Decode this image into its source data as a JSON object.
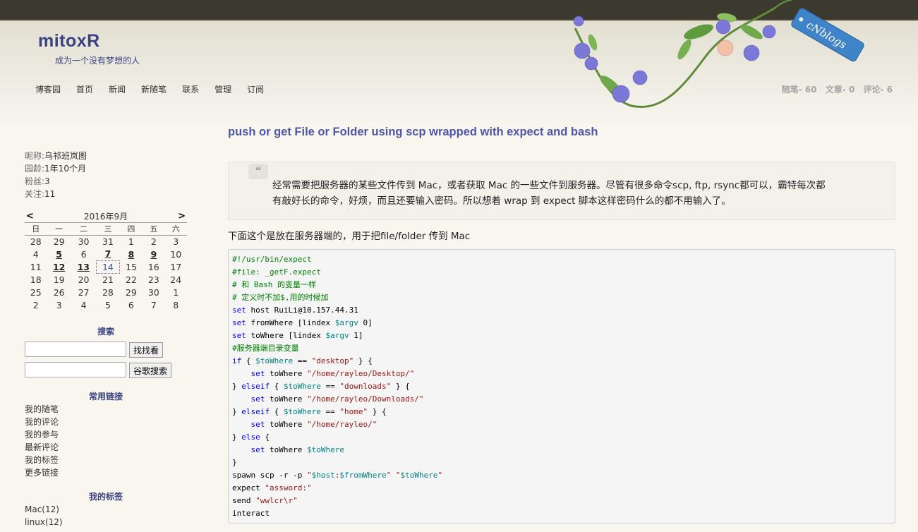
{
  "header": {
    "title": "mitoxR",
    "subtitle": "成为一个没有梦想的人",
    "nav": [
      "博客园",
      "首页",
      "新闻",
      "新随笔",
      "联系",
      "管理",
      "订阅"
    ],
    "stats": [
      "随笔- 60",
      "文章- 0",
      "评论- 6"
    ],
    "badge": "cNblogs"
  },
  "profile": {
    "nickname_label": "昵称:",
    "nickname": "乌祁班岚图",
    "age_label": "园龄:",
    "age": "1年10个月",
    "fans_label": "粉丝:",
    "fans": "3",
    "follow_label": "关注:",
    "follow": "11"
  },
  "calendar": {
    "prev": "<",
    "next": ">",
    "month": "2016年9月",
    "weekdays": [
      "日",
      "一",
      "二",
      "三",
      "四",
      "五",
      "六"
    ],
    "weeks": [
      [
        "28",
        "29",
        "30",
        "31",
        "1",
        "2",
        "3"
      ],
      [
        "4",
        "5",
        "6",
        "7",
        "8",
        "9",
        "10"
      ],
      [
        "11",
        "12",
        "13",
        "14",
        "15",
        "16",
        "17"
      ],
      [
        "18",
        "19",
        "20",
        "21",
        "22",
        "23",
        "24"
      ],
      [
        "25",
        "26",
        "27",
        "28",
        "29",
        "30",
        "1"
      ],
      [
        "2",
        "3",
        "4",
        "5",
        "6",
        "7",
        "8"
      ]
    ],
    "linked_days": [
      "5",
      "7",
      "8",
      "9",
      "12",
      "13"
    ],
    "today": "14"
  },
  "search": {
    "title": "搜索",
    "button1": "找找看",
    "button2": "谷歌搜索"
  },
  "links": {
    "title": "常用链接",
    "items": [
      "我的随笔",
      "我的评论",
      "我的参与",
      "最新评论",
      "我的标签",
      "更多链接"
    ]
  },
  "tags": {
    "title": "我的标签",
    "items": [
      "Mac(12)",
      "linux(12)"
    ]
  },
  "post": {
    "title": "push or get File or Folder using scp wrapped with expect and bash",
    "quote_mark": "“",
    "quote_line1": "经常需要把服务器的某些文件传到 Mac，或者获取 Mac 的一些文件到服务器。尽管有很多命令scp, ftp, rsync都可以，霸特每次都",
    "quote_line2": "有敲好长的命令，好烦，而且还要输入密码。所以想着 wrap 到 expect 脚本这样密码什么的都不用输入了。",
    "intro": "下面这个是放在服务器端的，用于把file/folder 传到 Mac",
    "code_lines": [
      "#!/usr/bin/expect",
      "#file: _getF.expect",
      "# 和 Bash 的变量一样",
      "# 定义时不加$,用的时候加",
      "set host RuiLi@10.157.44.31",
      "set fromWhere [lindex $argv 0]",
      "set toWhere [lindex $argv 1]",
      "#服务器端目录变量",
      "if { $toWhere == \"desktop\" } {",
      "    set toWhere \"/home/rayleo/Desktop/\"",
      "} elseif { $toWhere == \"downloads\" } {",
      "    set toWhere \"/home/rayleo/Downloads/\"",
      "} elseif { $toWhere == \"home\" } {",
      "    set toWhere \"/home/rayleo/\"",
      "} else {",
      "    set toWhere $toWhere",
      "}",
      "spawn scp -r -p \"$host:$fromWhere\" \"$toWhere\"",
      "expect \"assword:\"",
      "send \"wwlcr\\r\"",
      "interact"
    ]
  },
  "colors": {
    "topbar": "#3c3a2f",
    "title": "#3b4283",
    "post_title": "#4f56a8",
    "background": "#f8f6ef"
  }
}
